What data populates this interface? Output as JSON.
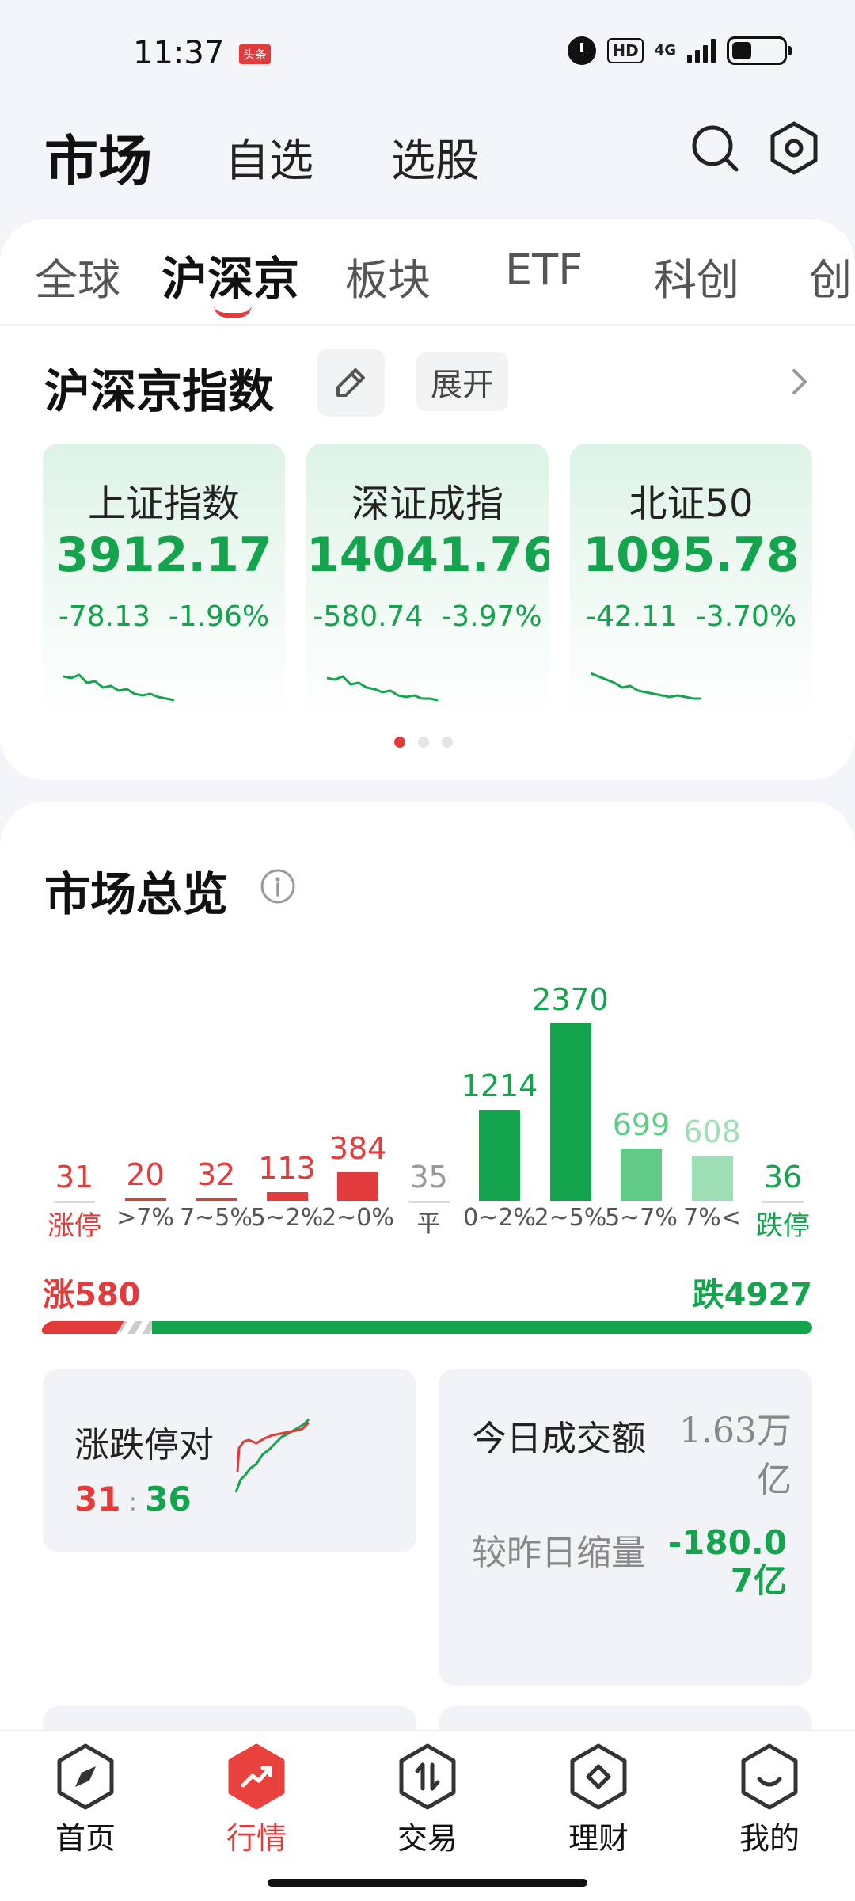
{
  "status": {
    "time": "11:37",
    "badge": "头条",
    "hd": "HD",
    "network": "4G"
  },
  "header": {
    "title": "市场",
    "tabs": [
      "自选",
      "选股"
    ]
  },
  "market_tabs": [
    "全球",
    "沪深京",
    "板块",
    "ETF",
    "科创",
    "创"
  ],
  "active_market_tab": "沪深京",
  "indices": {
    "title": "沪深京指数",
    "expand_label": "展开",
    "cards": [
      {
        "name": "上证指数",
        "value": "3912.17",
        "change": "-78.13",
        "pct": "-1.96%"
      },
      {
        "name": "深证成指",
        "value": "14041.76",
        "change": "-580.74",
        "pct": "-3.97%"
      },
      {
        "name": "北证50",
        "value": "1095.78",
        "change": "-42.11",
        "pct": "-3.70%"
      }
    ]
  },
  "overview": {
    "title": "市场总览",
    "distribution": [
      {
        "label": "涨停",
        "value": 31,
        "kind": "up-limit"
      },
      {
        "label": ">7%",
        "value": 20,
        "kind": "up"
      },
      {
        "label": "7~5%",
        "value": 32,
        "kind": "up"
      },
      {
        "label": "5~2%",
        "value": 113,
        "kind": "up"
      },
      {
        "label": "2~0%",
        "value": 384,
        "kind": "up"
      },
      {
        "label": "平",
        "value": 35,
        "kind": "flat"
      },
      {
        "label": "0~2%",
        "value": 1214,
        "kind": "down"
      },
      {
        "label": "2~5%",
        "value": 2370,
        "kind": "down"
      },
      {
        "label": "5~7%",
        "value": 699,
        "kind": "down-light"
      },
      {
        "label": "7%<",
        "value": 608,
        "kind": "down-lighter"
      },
      {
        "label": "跌停",
        "value": 36,
        "kind": "down-limit"
      }
    ],
    "up_total": "涨580",
    "down_total": "跌4927",
    "up_count": 580,
    "down_count": 4927,
    "limit_card": {
      "label": "涨跌停对",
      "up": "31",
      "sep": ":",
      "down": "36"
    },
    "turnover_card": {
      "label1": "今日成交额",
      "value1": "1.63万亿",
      "label2": "较昨日缩量",
      "value2": "-180.07亿"
    }
  },
  "colors": {
    "up": "#e23b3b",
    "down": "#14a44d",
    "down_light": "#5fcb86",
    "down_lighter": "#9fdfb5",
    "flat": "#999999"
  },
  "nav": {
    "items": [
      {
        "label": "首页",
        "icon": "compass-icon"
      },
      {
        "label": "行情",
        "icon": "trend-icon"
      },
      {
        "label": "交易",
        "icon": "trade-icon"
      },
      {
        "label": "理财",
        "icon": "wealth-icon"
      },
      {
        "label": "我的",
        "icon": "profile-icon"
      }
    ],
    "active": "行情"
  }
}
